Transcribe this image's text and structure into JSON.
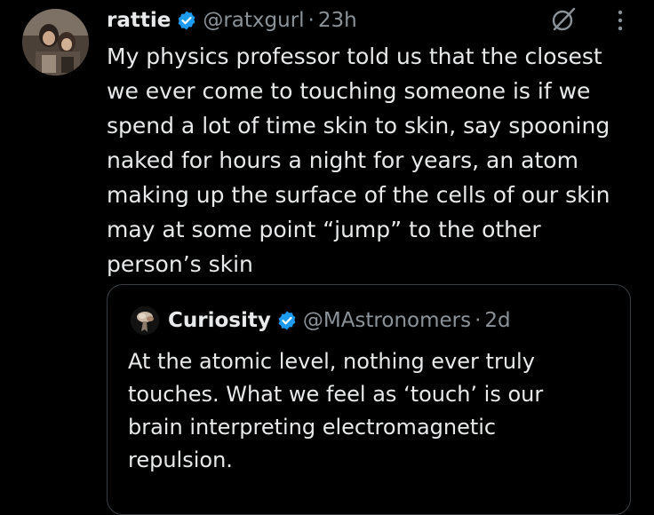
{
  "tweet": {
    "author": {
      "display_name": "rattie",
      "handle": "@ratxgurl",
      "verified": true
    },
    "separator": "·",
    "time": "23h",
    "text_lines": [
      "My physics professor told us that the closest",
      "we ever come to touching someone is if we",
      "spend a lot of time skin to skin, say spooning",
      "naked for hours a night for years, an atom",
      "making up the surface of the cells of our skin",
      "may at some point “jump” to the other",
      "person’s skin"
    ],
    "actions": {
      "grok_icon": "grok-icon",
      "more_icon": "more-options-icon"
    }
  },
  "quote": {
    "author": {
      "display_name": "Curiosity",
      "handle": "@MAstronomers",
      "verified": true
    },
    "separator": "·",
    "time": "2d",
    "text_lines": [
      "At the atomic level, nothing ever truly",
      "touches. What we feel as ‘touch’ is our",
      "brain interpreting electromagnetic",
      "repulsion."
    ]
  },
  "colors": {
    "background": "#000000",
    "text_primary": "#e7e9ea",
    "text_secondary": "#8b9298",
    "verified_blue": "#1d9bf0",
    "card_border": "#3a3f44"
  }
}
